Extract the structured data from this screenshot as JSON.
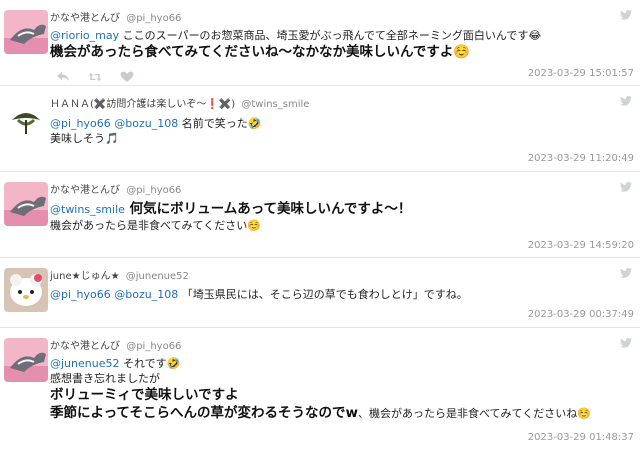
{
  "tweets": [
    {
      "name": "かなや港とんび",
      "handle": "@pi_hyo66",
      "lines": [
        {
          "mention": "@riorio_may",
          "text": " ここのスーパーのお惣菜商品、埼玉愛がぶっ飛んでて全部ネーミング面白いんです😂",
          "big": false
        },
        {
          "mention": "",
          "text": "機会があったら食べてみてくださいね〜なかなか美味しいんですよ☺️",
          "big": true
        }
      ],
      "timestamp": "2023-03-29 15:01:57"
    },
    {
      "name": "ＨＡＮＡ(✖️訪問介護は楽しいぞ〜❗️✖️)",
      "handle": "@twins_smile",
      "lines": [
        {
          "mention": "@pi_hyo66 @bozu_108",
          "text": " 名前で笑った🤣",
          "big": false
        },
        {
          "mention": "",
          "text": "美味しそう🎵",
          "big": false
        }
      ],
      "timestamp": "2023-03-29 11:20:49"
    },
    {
      "name": "かなや港とんび",
      "handle": "@pi_hyo66",
      "lines": [
        {
          "mention": "@twins_smile",
          "text": " 何気にボリュームあって美味しいんですよ〜！",
          "big": true,
          "mixed": true
        },
        {
          "mention": "",
          "text": "機会があったら是非食べてみてください☺️",
          "big": false
        }
      ],
      "timestamp": "2023-03-29 14:59:20"
    },
    {
      "name": "june★じゅん★",
      "handle": "@junenue52",
      "lines": [
        {
          "mention": "@pi_hyo66 @bozu_108",
          "text": " 「埼玉県民には、そこら辺の草でも食わしとけ」ですね。",
          "big": false
        }
      ],
      "timestamp": "2023-03-29 00:37:49"
    },
    {
      "name": "かなや港とんび",
      "handle": "@pi_hyo66",
      "lines": [
        {
          "mention": "@junenue52",
          "text": " それです🤣",
          "big": false
        },
        {
          "mention": "",
          "text": "感想書き忘れましたが",
          "big": false
        },
        {
          "mention": "",
          "text": "ボリューミィで美味しいですよ",
          "big": true
        },
        {
          "mention": "",
          "text": "季節によってそこらへんの草が変わるそうなのでw",
          "big": true,
          "tail": "、機会があったら是非食べてみてくださいね☺️"
        }
      ],
      "timestamp": "2023-03-29 01:48:37"
    }
  ],
  "colors": {
    "mention": "#1d6fb8",
    "timestamp": "#999999",
    "divider": "#e6e6e6"
  }
}
